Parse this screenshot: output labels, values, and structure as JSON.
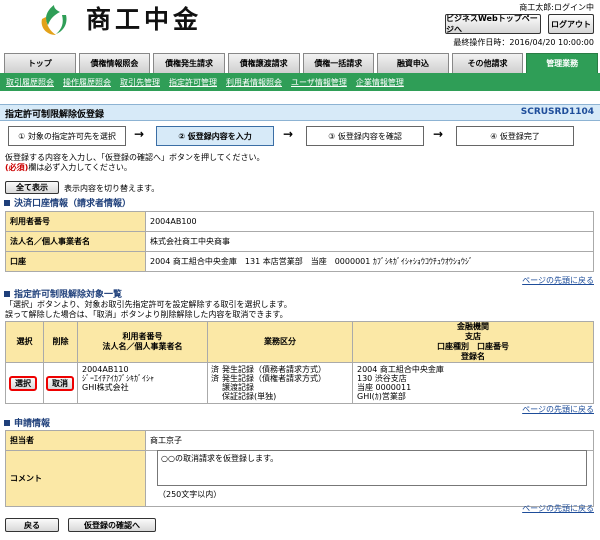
{
  "header": {
    "logo_text": "商工中金",
    "user_name": "商工太郎:ログイン中",
    "btn_top_page": "ビジネスWebトップページへ",
    "btn_logout": "ログアウト",
    "last_operation": "最終操作日時：2016/04/20 10:00:00"
  },
  "tabs": [
    {
      "label": "トップ"
    },
    {
      "label": "債権情報照会"
    },
    {
      "label": "債権発生請求"
    },
    {
      "label": "債権譲渡請求"
    },
    {
      "label": "債権一括請求"
    },
    {
      "label": "融資申込"
    },
    {
      "label": "その他請求"
    },
    {
      "label": "管理業務",
      "active": true
    }
  ],
  "subnav": [
    "取引履歴照会",
    "操作履歴照会",
    "取引先管理",
    "指定許可管理",
    "利用者情報照会",
    "ユーザ情報管理",
    "企業情報管理"
  ],
  "title": {
    "text": "指定許可制限解除仮登録",
    "screen_id": "SCRUSRD1104"
  },
  "steps": [
    "① 対象の指定許可先を選択",
    "② 仮登録内容を入力",
    "③ 仮登録内容を確認",
    "④ 仮登録完了"
  ],
  "intro": {
    "line1": "仮登録する内容を入力し、「仮登録の確認へ」ボタンを押してください。",
    "line2_req": "(必須)",
    "line2_rest": "欄は必ず入力してください。"
  },
  "toggle": {
    "button": "全て表示",
    "note": "表示内容を切り替えます。"
  },
  "settlement": {
    "heading": "決済口座情報（請求者情報）",
    "rows": [
      {
        "key": "利用者番号",
        "value": "2004AB100"
      },
      {
        "key": "法人名／個人事業者名",
        "value": "株式会社商工中央商事"
      },
      {
        "key": "口座",
        "value": "2004 商工組合中央金庫　131 本店営業部　当座　0000001 ｶﾌﾞｼｷｶﾞｲｼｬｼｮｳｺｳﾁｭｳｵｳｼｮｳｼﾞ"
      }
    ]
  },
  "back_to_top": "ページの先頭に戻る",
  "target": {
    "heading": "指定許可制限解除対象一覧",
    "note1": "「選択」ボタンより、対象お取引先指定許可を設定解除する取引を選択します。",
    "note2": "誤って解除した場合は、「取消」ボタンより削除解除した内容を取消できます。",
    "headers": {
      "select": "選択",
      "delete": "削除",
      "user": [
        "利用者番号",
        "法人名／個人事業者名"
      ],
      "type": "業務区分",
      "bank": [
        "金融機関",
        "支店",
        "口座種別　口座番号",
        "登録名"
      ]
    },
    "row": {
      "select_btn": "選択",
      "cancel_btn": "取消",
      "user": [
        "2004AB110",
        "ｼﾞｰｴｲﾁｱｲｶﾌﾞｼｷｶﾞｲｼｬ",
        "GHI株式会社"
      ],
      "marks": [
        "済",
        "済",
        "",
        ""
      ],
      "types": [
        "発生記録（債務者請求方式）",
        "発生記録（債権者請求方式）",
        "譲渡記録",
        "保証記録(単独)"
      ],
      "bank": [
        "2004 商工組合中央金庫",
        "130 渋谷支店",
        "当座 0000011",
        "GHI(ｶ)営業部"
      ]
    }
  },
  "application": {
    "heading": "申請情報",
    "person_label": "担当者",
    "person_value": "商工京子",
    "comment_label": "コメント",
    "comment_value": "○○の取消請求を仮登録します。",
    "comment_limit": "（250文字以内）"
  },
  "footer": {
    "back": "戻る",
    "confirm": "仮登録の確認へ"
  }
}
